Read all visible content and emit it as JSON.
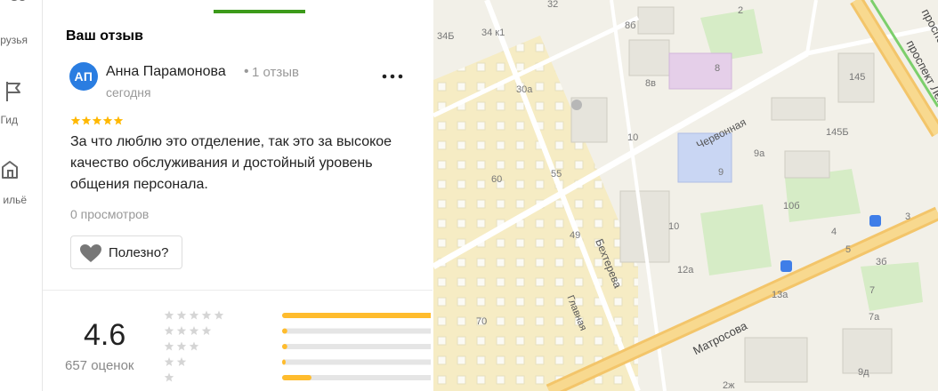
{
  "nav": {
    "items": [
      {
        "label": "рузья",
        "icon": "friends-icon"
      },
      {
        "label": "Гид",
        "icon": "flag-icon"
      },
      {
        "label": "ильё",
        "icon": "housing-icon"
      }
    ]
  },
  "review": {
    "section_title": "Ваш отзыв",
    "author": {
      "initials": "АП",
      "name": "Анна Парамонова",
      "separator": "•",
      "review_count": "1 отзыв",
      "avatar_color": "#2a7de1"
    },
    "date": "сегодня",
    "stars": 5,
    "star_color": "#ffb800",
    "text": "За что люблю это отделение, так это за высокое качество обслуживания и достойный уровень общения персонала.",
    "views": "0 просмотров",
    "useful_label": "Полезно?",
    "more_icon": "more-dots-icon"
  },
  "rating": {
    "value": "4.6",
    "count_label": "657 оценок",
    "bar_color": "#ffbc2d",
    "distribution": [
      {
        "stars": 5,
        "fraction": 1.0
      },
      {
        "stars": 4,
        "fraction": 0.03
      },
      {
        "stars": 3,
        "fraction": 0.03
      },
      {
        "stars": 2,
        "fraction": 0.02
      },
      {
        "stars": 1,
        "fraction": 0.17
      }
    ]
  },
  "map": {
    "streets": [
      "Червонная",
      "Бехтерева",
      "Главная",
      "Матросова",
      "проспект Ленина",
      "проспект Лени"
    ],
    "house_numbers": [
      "32",
      "34Б",
      "34 к1",
      "8б",
      "2",
      "8",
      "8в",
      "145",
      "30а",
      "10",
      "145Б",
      "9а",
      "9",
      "60",
      "55",
      "10б",
      "49",
      "10",
      "3",
      "4",
      "5",
      "3б",
      "12а",
      "13а",
      "7",
      "70",
      "7а",
      "9д",
      "2ж"
    ]
  }
}
